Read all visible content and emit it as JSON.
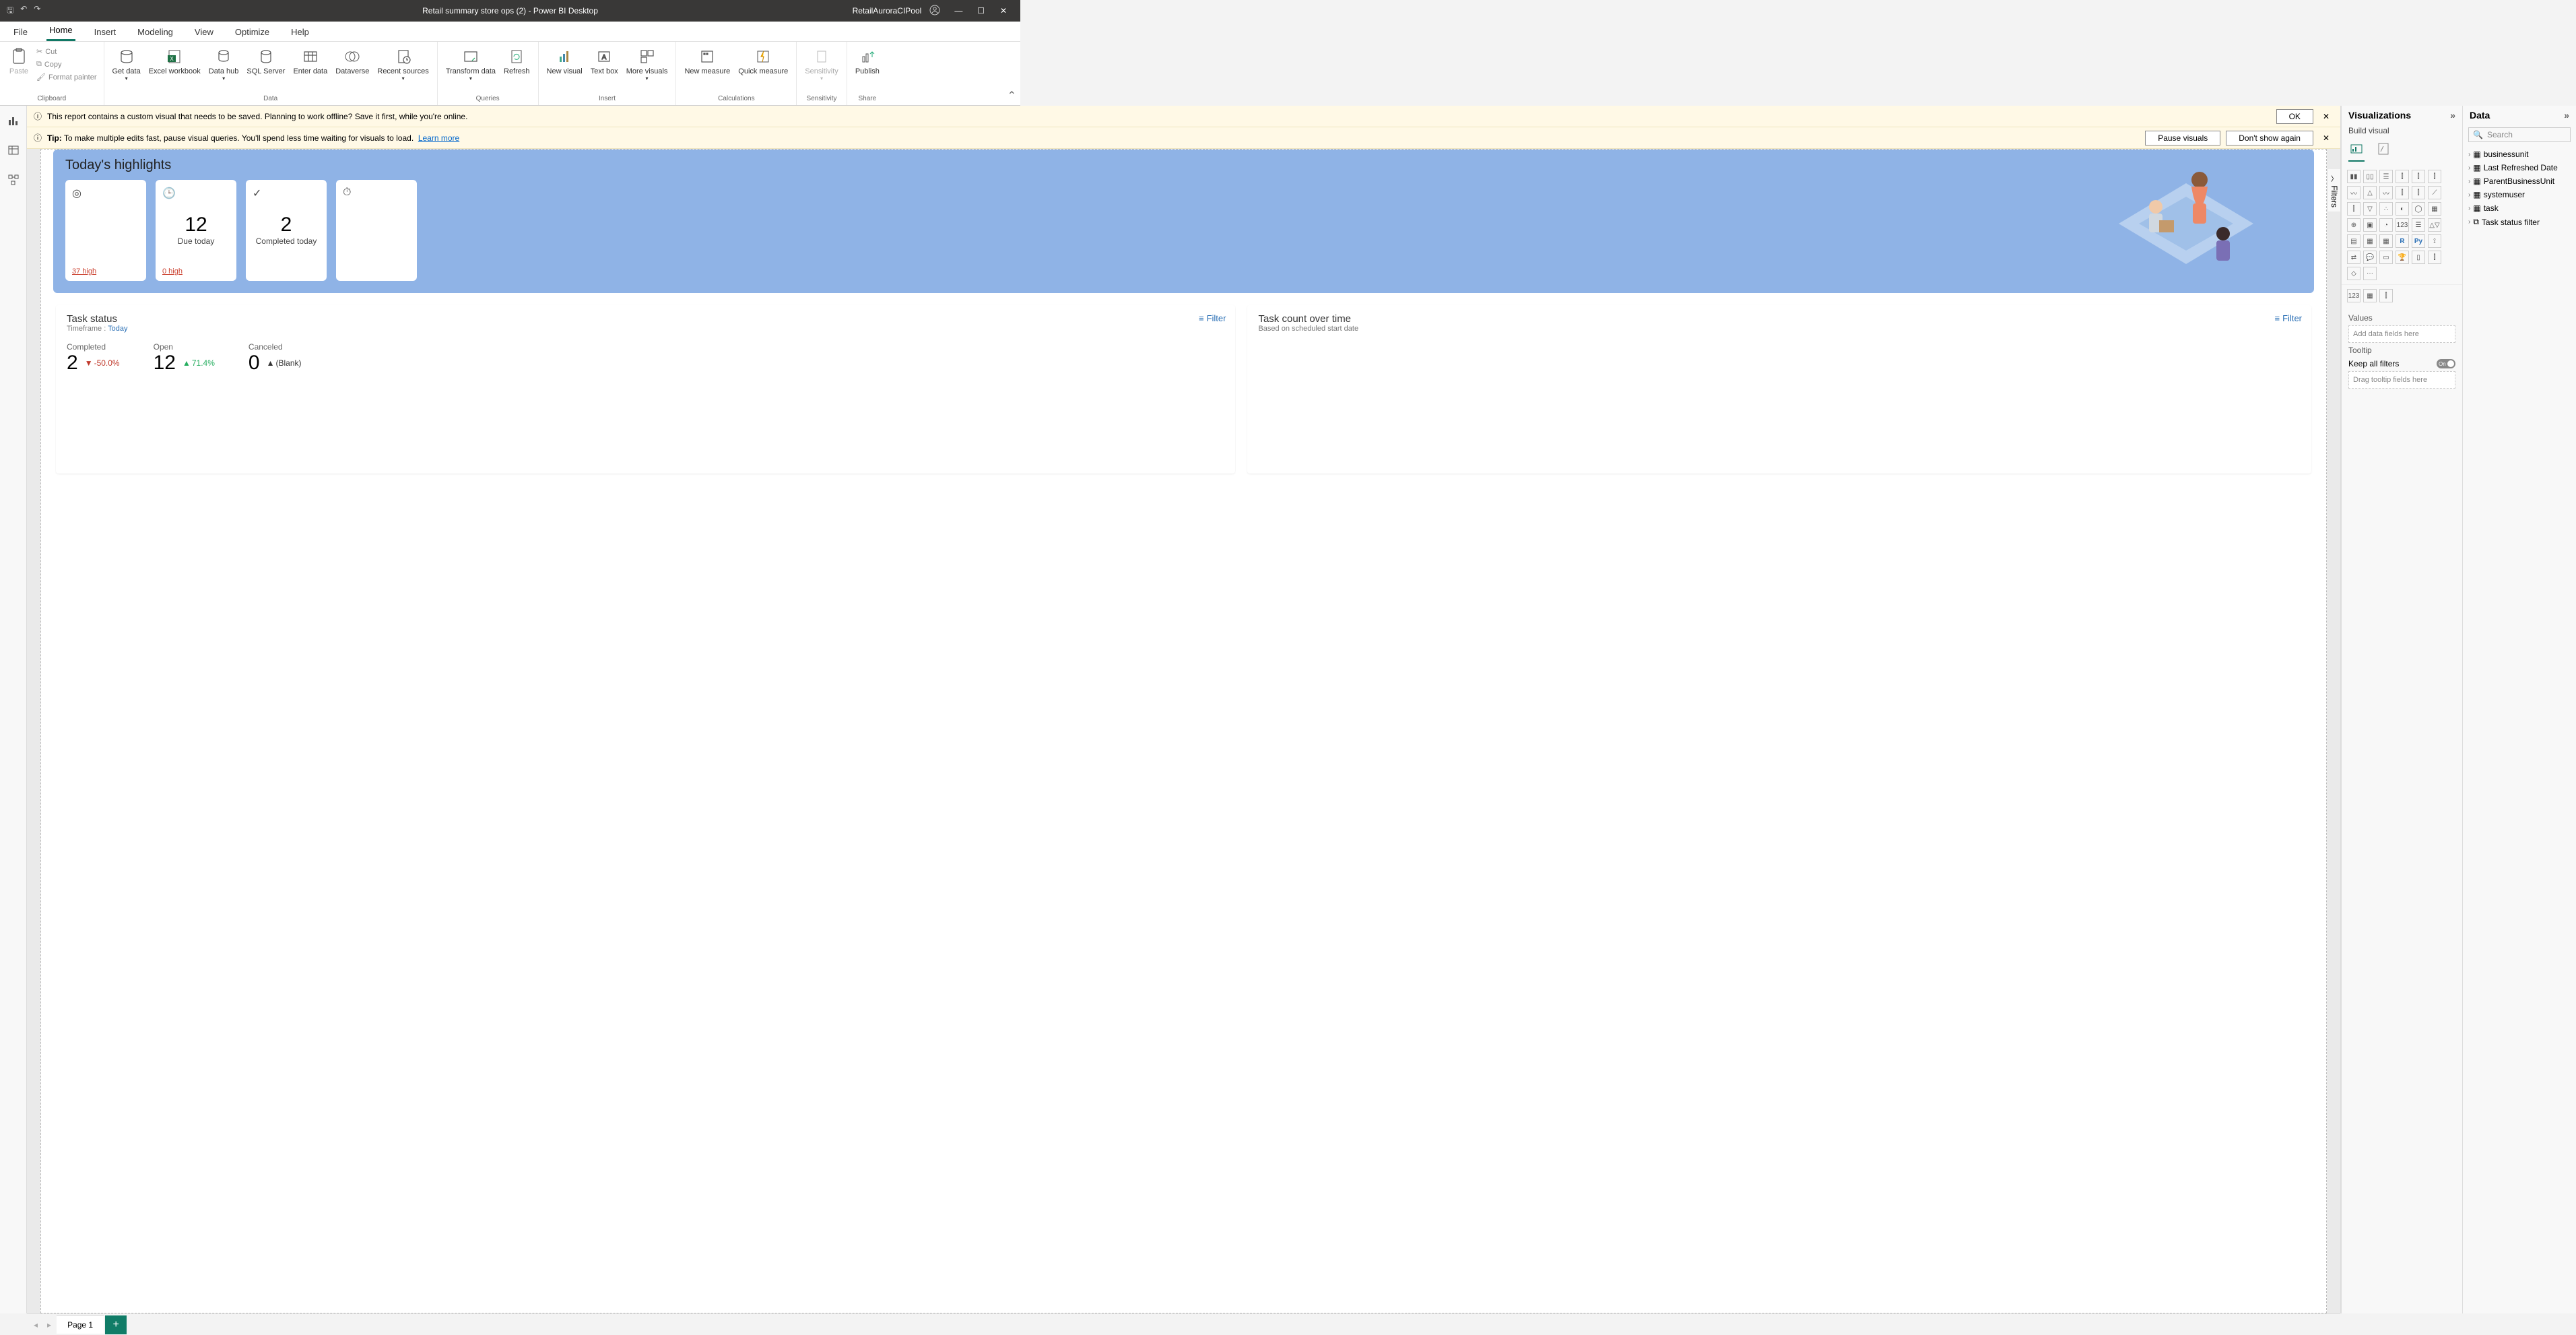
{
  "titlebar": {
    "title": "Retail summary store ops (2) - Power BI Desktop",
    "account": "RetailAuroraCIPool"
  },
  "menu": {
    "tabs": [
      "File",
      "Home",
      "Insert",
      "Modeling",
      "View",
      "Optimize",
      "Help"
    ],
    "active": "Home"
  },
  "ribbon": {
    "clipboard": {
      "label": "Clipboard",
      "paste": "Paste",
      "cut": "Cut",
      "copy": "Copy",
      "format_painter": "Format painter"
    },
    "data": {
      "label": "Data",
      "get_data": "Get data",
      "excel": "Excel workbook",
      "datahub": "Data hub",
      "sql": "SQL Server",
      "enter": "Enter data",
      "dataverse": "Dataverse",
      "recent": "Recent sources"
    },
    "queries": {
      "label": "Queries",
      "transform": "Transform data",
      "refresh": "Refresh"
    },
    "insert": {
      "label": "Insert",
      "new_visual": "New visual",
      "text_box": "Text box",
      "more": "More visuals"
    },
    "calc": {
      "label": "Calculations",
      "new_measure": "New measure",
      "quick_measure": "Quick measure"
    },
    "sensitivity": {
      "label": "Sensitivity",
      "btn": "Sensitivity"
    },
    "share": {
      "label": "Share",
      "publish": "Publish"
    }
  },
  "banners": {
    "warn1": {
      "text": "This report contains a custom visual that needs to be saved. Planning to work offline? Save it first, while you're online.",
      "ok": "OK"
    },
    "warn2": {
      "tip_label": "Tip:",
      "text": "To make multiple edits fast, pause visual queries. You'll spend less time waiting for visuals to load.",
      "learn_more": "Learn more",
      "pause": "Pause visuals",
      "dont_show": "Don't show again"
    }
  },
  "filters_tab": "Filters",
  "viz_pane": {
    "title": "Visualizations",
    "subtitle": "Build visual",
    "values_label": "Values",
    "values_placeholder": "Add data fields here",
    "tooltip_label": "Tooltip",
    "keep_filters": "Keep all filters",
    "toggle_state": "On",
    "tooltip_placeholder": "Drag tooltip fields here"
  },
  "data_pane": {
    "title": "Data",
    "search_placeholder": "Search",
    "items": [
      "businessunit",
      "Last Refreshed Date",
      "ParentBusinessUnit",
      "systemuser",
      "task",
      "Task status filter"
    ]
  },
  "pagetabs": {
    "page1": "Page 1"
  },
  "report": {
    "hero": {
      "title": "Today's highlights",
      "cards": [
        {
          "icon": "target",
          "big": "",
          "label": "",
          "foot": "37 high"
        },
        {
          "icon": "clock",
          "big": "12",
          "label": "Due today",
          "foot": "0 high"
        },
        {
          "icon": "check",
          "big": "2",
          "label": "Completed today",
          "foot": ""
        },
        {
          "icon": "timer",
          "big": "",
          "label": "",
          "foot": ""
        }
      ]
    },
    "task_status": {
      "title": "Task status",
      "timeframe_label": "Timeframe :",
      "timeframe_value": "Today",
      "filter": "Filter",
      "kpis": [
        {
          "label": "Completed",
          "value": "2",
          "delta": "-50.0%",
          "dir": "down"
        },
        {
          "label": "Open",
          "value": "12",
          "delta": "71.4%",
          "dir": "up"
        },
        {
          "label": "Canceled",
          "value": "0",
          "delta": "(Blank)",
          "dir": "up"
        }
      ]
    },
    "task_count": {
      "title": "Task count over time",
      "subtitle": "Based on scheduled start date",
      "filter": "Filter"
    }
  }
}
